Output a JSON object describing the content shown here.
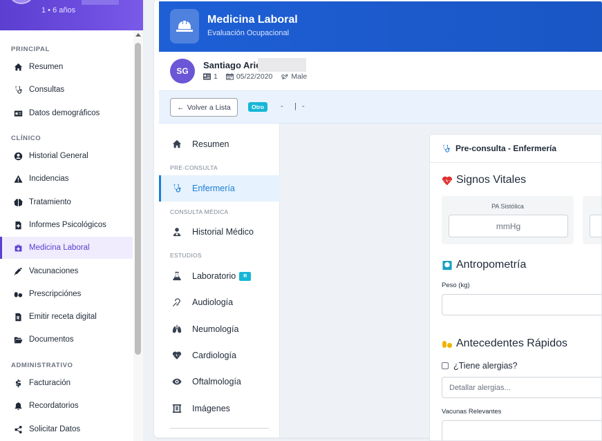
{
  "profile": {
    "meta": "1 • 6 años"
  },
  "menu": {
    "sections": [
      "PRINCIPAL",
      "CLÍNICO",
      "ADMINISTRATIVO"
    ],
    "items": [
      {
        "label": "Resumen",
        "icon": "home-icon"
      },
      {
        "label": "Consultas",
        "icon": "stethoscope-icon"
      },
      {
        "label": "Datos demográficos",
        "icon": "id-card-icon"
      },
      {
        "label": "Historial General",
        "icon": "user-circle-icon"
      },
      {
        "label": "Incidencias",
        "icon": "warning-icon"
      },
      {
        "label": "Tratamiento",
        "icon": "brain-icon"
      },
      {
        "label": "Informes Psicológicos",
        "icon": "file-medical-icon"
      },
      {
        "label": "Medicina Laboral",
        "icon": "briefcase-medical-icon"
      },
      {
        "label": "Vacunaciones",
        "icon": "syringe-icon"
      },
      {
        "label": "Prescripciónes",
        "icon": "pills-icon"
      },
      {
        "label": "Emitir receta digital",
        "icon": "file-prescription-icon"
      },
      {
        "label": "Documentos",
        "icon": "folder-open-icon"
      },
      {
        "label": "Facturación",
        "icon": "dollar-icon"
      },
      {
        "label": "Recordatorios",
        "icon": "bell-icon"
      },
      {
        "label": "Solicitar Datos",
        "icon": "share-icon"
      }
    ],
    "active": "Medicina Laboral"
  },
  "header": {
    "title": "Medicina Laboral",
    "subtitle": "Evaluación Ocupacional",
    "icon": "hard-hat-icon"
  },
  "patient": {
    "initials": "SG",
    "name": "Santiago Arie",
    "id": "1",
    "birthdate": "05/22/2020",
    "gender": "Male"
  },
  "toolbar": {
    "back_label": "Volver a Lista",
    "badge": "Otro",
    "dash1": "-",
    "sep": "|",
    "dash2": "-"
  },
  "subnav": {
    "summary": "Resumen",
    "sections": [
      "PRE-CONSULTA",
      "CONSULTA MÉDICA",
      "ESTUDIOS"
    ],
    "preconsulta": "Enfermería",
    "consulta": "Historial Médico",
    "estudios": [
      {
        "label": "Laboratorio",
        "badge": "R",
        "icon": "flask-icon"
      },
      {
        "label": "Audiología",
        "icon": "deaf-icon"
      },
      {
        "label": "Neumología",
        "icon": "lungs-icon"
      },
      {
        "label": "Cardiología",
        "icon": "heartbeat-icon"
      },
      {
        "label": "Oftalmología",
        "icon": "eye-icon"
      },
      {
        "label": "Imágenes",
        "icon": "x-ray-icon"
      }
    ]
  },
  "form": {
    "panel_title": "Pre-consulta - Enfermería",
    "vitals_title": "Signos Vitales",
    "pa_label": "PA Sistólica",
    "pa_placeholder": "mmHg",
    "anthro_title": "Antropometría",
    "weight_label": "Peso (kg)",
    "history_title": "Antecedentes Rápidos",
    "allergy_check": "¿Tiene alergias?",
    "allergy_placeholder": "Detallar alergias...",
    "vaccines_label": "Vacunas Relevantes"
  },
  "colors": {
    "brand_purple": "#5a3fd0",
    "header_blue": "#1e5fd6",
    "active_blue": "#1c7ed6",
    "badge_cyan": "#16b6d6",
    "vitals_red": "#e03131",
    "pills_yellow": "#f0b400"
  }
}
